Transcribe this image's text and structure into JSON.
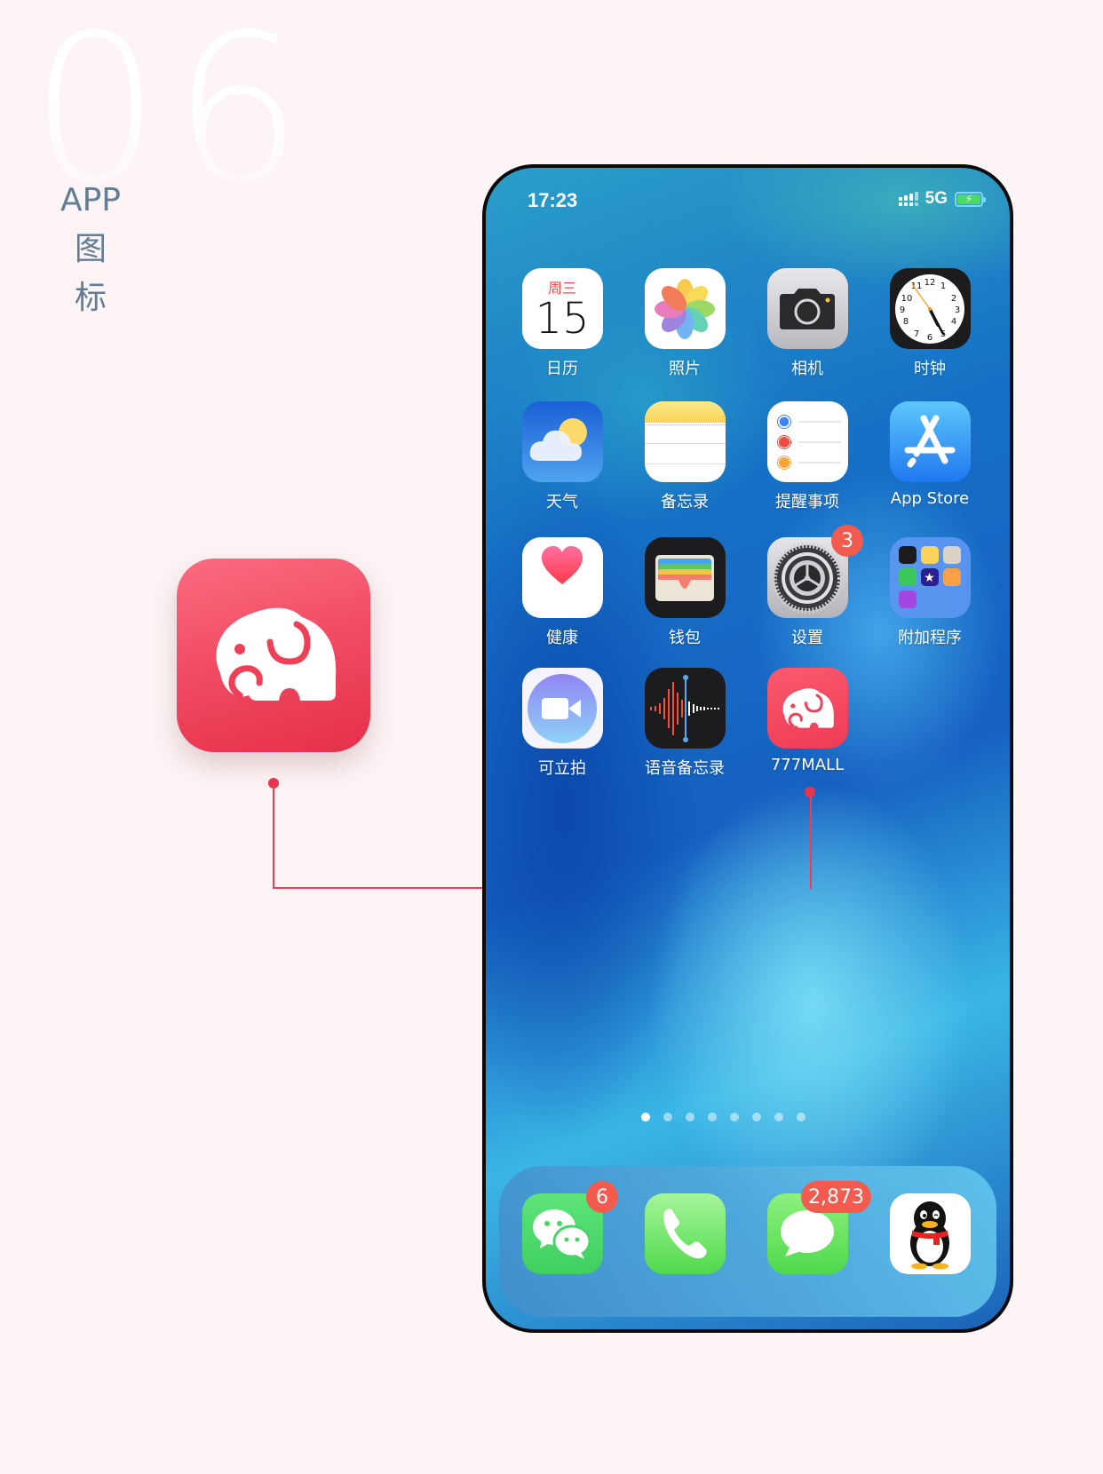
{
  "section": {
    "number": "06",
    "title_lines": [
      "APP",
      "图",
      "标"
    ]
  },
  "colors": {
    "brand": "#ef4058",
    "connector": "#e8354e",
    "title_text": "#627d95",
    "badge": "#f25b4d"
  },
  "featured_icon": {
    "name": "777MALL",
    "icon": "elephant-icon"
  },
  "status_bar": {
    "time": "17:23",
    "network": "5G",
    "battery_state": "charging"
  },
  "home_apps": [
    {
      "label": "日历",
      "icon": "calendar-icon",
      "weekday": "周三",
      "day": "15"
    },
    {
      "label": "照片",
      "icon": "photos-icon"
    },
    {
      "label": "相机",
      "icon": "camera-icon"
    },
    {
      "label": "时钟",
      "icon": "clock-icon"
    },
    {
      "label": "天气",
      "icon": "weather-icon"
    },
    {
      "label": "备忘录",
      "icon": "notes-icon"
    },
    {
      "label": "提醒事项",
      "icon": "reminders-icon"
    },
    {
      "label": "App Store",
      "icon": "app-store-icon"
    },
    {
      "label": "健康",
      "icon": "health-icon"
    },
    {
      "label": "钱包",
      "icon": "wallet-icon"
    },
    {
      "label": "设置",
      "icon": "settings-icon",
      "badge": "3"
    },
    {
      "label": "附加程序",
      "icon": "folder-icon"
    },
    {
      "label": "可立拍",
      "icon": "clips-icon"
    },
    {
      "label": "语音备忘录",
      "icon": "voice-memos-icon"
    },
    {
      "label": "777MALL",
      "icon": "elephant-icon"
    }
  ],
  "page_indicator": {
    "total": 8,
    "current": 1
  },
  "dock": [
    {
      "name": "WeChat",
      "icon": "wechat-icon",
      "badge": "6"
    },
    {
      "name": "Phone",
      "icon": "phone-icon"
    },
    {
      "name": "Messages",
      "icon": "messages-icon",
      "badge": "2,873"
    },
    {
      "name": "QQ",
      "icon": "qq-penguin-icon"
    }
  ]
}
